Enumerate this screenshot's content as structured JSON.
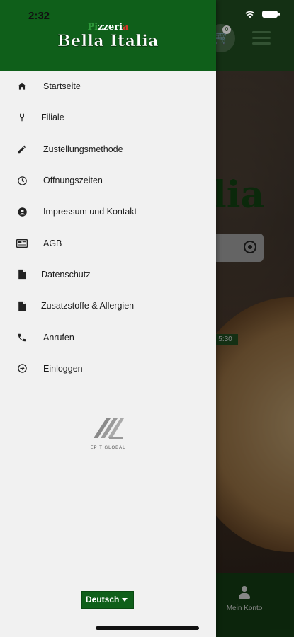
{
  "status_bar": {
    "time": "2:32"
  },
  "drawer": {
    "logo": {
      "line1_a": "Pi",
      "line1_b": "zzeri",
      "line1_c": "a",
      "line2": "Bella Italia"
    },
    "menu": [
      {
        "label": "Startseite",
        "icon": "home-icon"
      },
      {
        "label": "Filiale",
        "icon": "branch-icon"
      },
      {
        "label": "Zustellungsmethode",
        "icon": "pencil-icon"
      },
      {
        "label": "Öffnungszeiten",
        "icon": "clock-icon"
      },
      {
        "label": "Impressum und Kontakt",
        "icon": "account-circle-icon"
      },
      {
        "label": "AGB",
        "icon": "newspaper-icon"
      },
      {
        "label": "Datenschutz",
        "icon": "document-icon"
      },
      {
        "label": "Zusatzstoffe & Allergien",
        "icon": "document-icon"
      },
      {
        "label": "Anrufen",
        "icon": "phone-icon"
      },
      {
        "label": "Einloggen",
        "icon": "login-icon"
      }
    ],
    "brand_footer": "EPIT GLOBAL",
    "language": {
      "selected": "Deutsch"
    }
  },
  "background": {
    "title_partial": "lia",
    "cart_count": "0",
    "badge_text": "5:30",
    "bottom_nav_label": "Mein Konto"
  },
  "colors": {
    "primary_green": "#0f5f1a",
    "drawer_bg": "#f1f1f1"
  }
}
